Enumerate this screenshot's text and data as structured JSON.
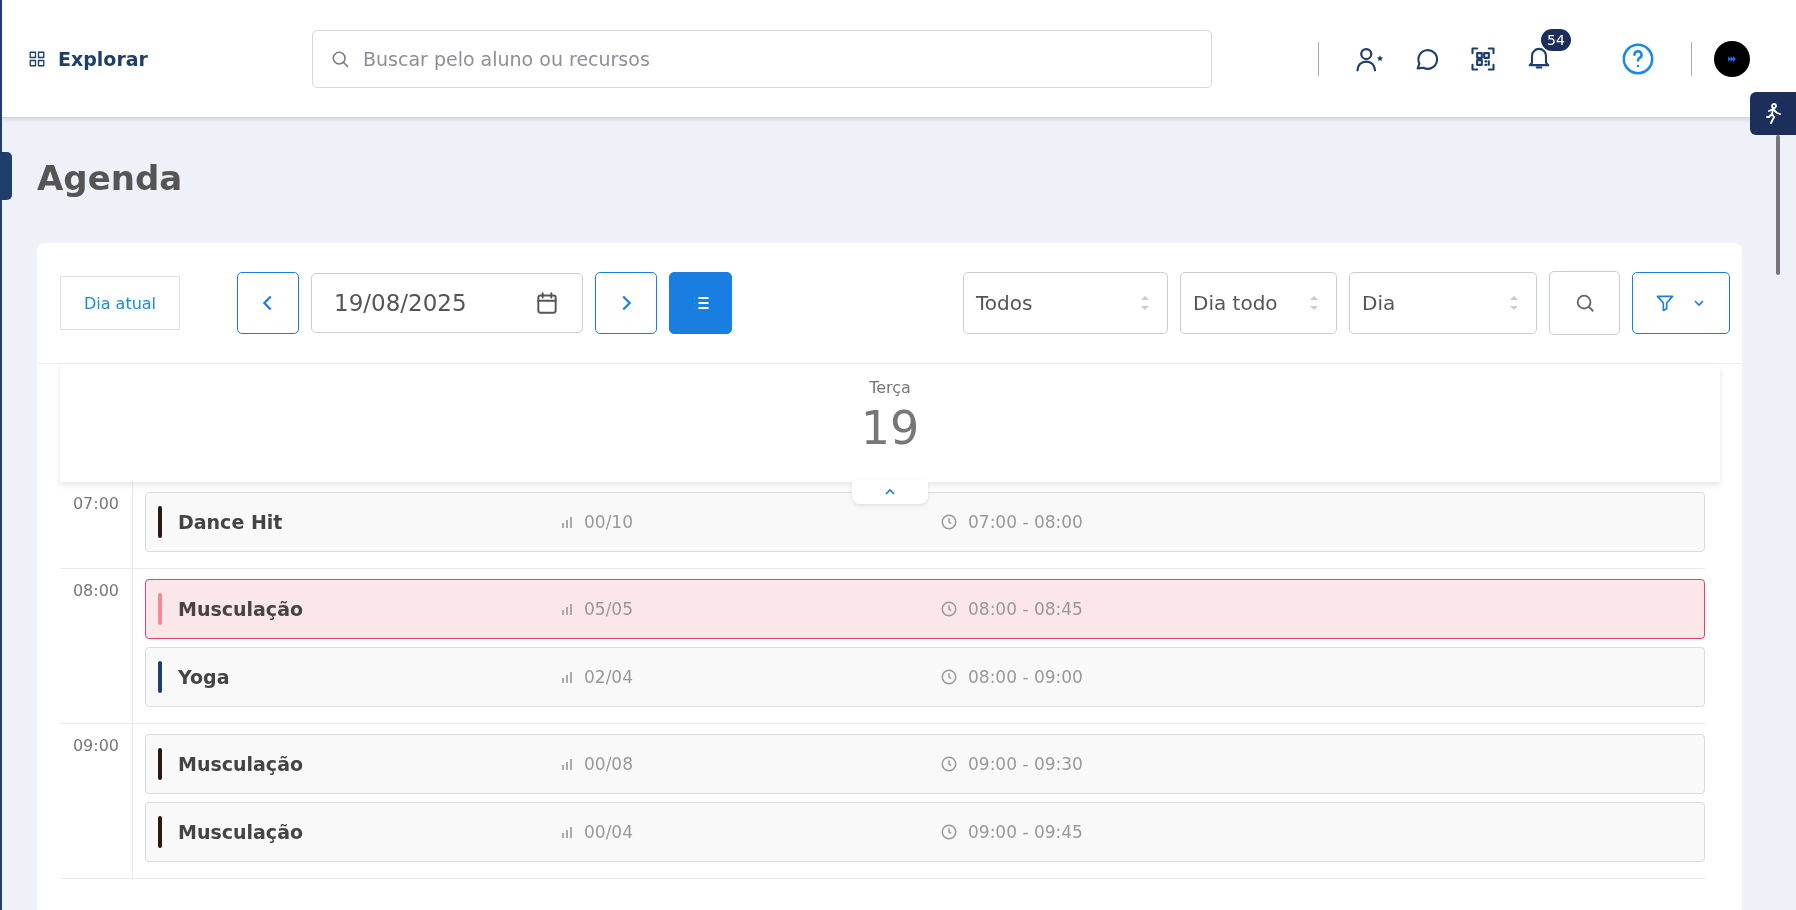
{
  "header": {
    "explore_label": "Explorar",
    "search": {
      "placeholder": "Buscar pelo aluno ou recursos"
    },
    "notifications_count": "54"
  },
  "page_title": "Agenda",
  "toolbar": {
    "today_button": "Dia atual",
    "date": "19/08/2025",
    "list_view_selected": true,
    "selects": [
      {
        "value": "Todos"
      },
      {
        "value": "Dia todo"
      },
      {
        "value": "Dia"
      }
    ]
  },
  "day_header": {
    "weekday": "Terça",
    "day": "19"
  },
  "slots": [
    {
      "time": "07:00",
      "events": [
        {
          "name": "Dance Hit",
          "capacity": "00/10",
          "hours": "07:00 - 08:00",
          "color": "#2a1a12",
          "full": false
        }
      ]
    },
    {
      "time": "08:00",
      "events": [
        {
          "name": "Musculação",
          "capacity": "05/05",
          "hours": "08:00 - 08:45",
          "color": "#f28b95",
          "full": true
        },
        {
          "name": "Yoga",
          "capacity": "02/04",
          "hours": "08:00 - 09:00",
          "color": "#1f3f6b",
          "full": false
        }
      ]
    },
    {
      "time": "09:00",
      "events": [
        {
          "name": "Musculação",
          "capacity": "00/08",
          "hours": "09:00 - 09:30",
          "color": "#2a1a12",
          "full": false
        },
        {
          "name": "Musculação",
          "capacity": "00/04",
          "hours": "09:00 - 09:45",
          "color": "#2a1a12",
          "full": false
        }
      ]
    }
  ]
}
